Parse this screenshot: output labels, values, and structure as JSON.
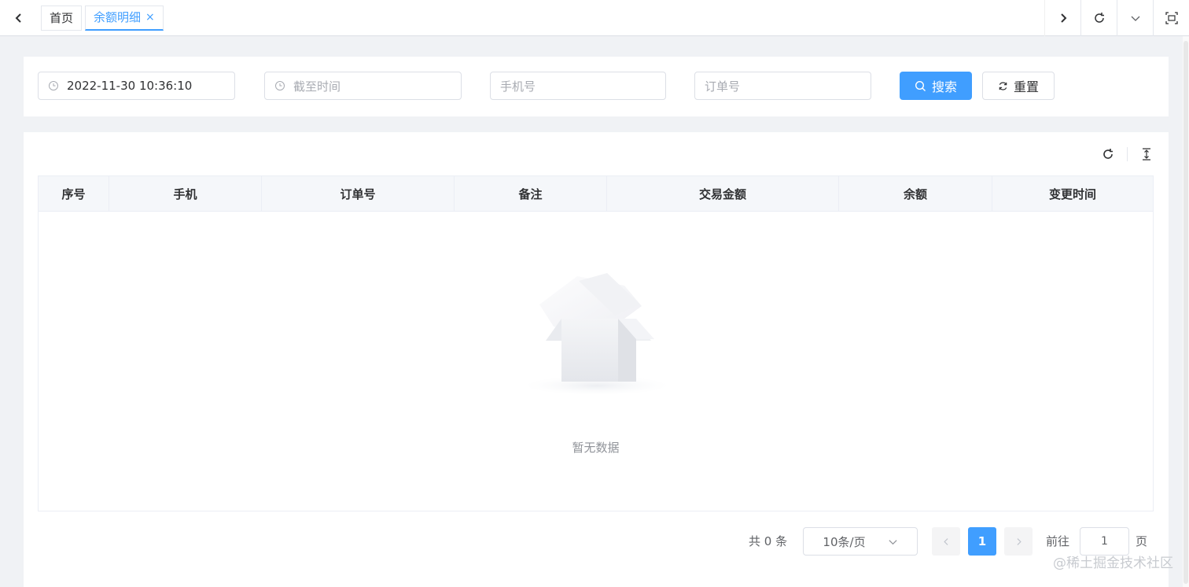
{
  "tabbar": {
    "prev_icon": "chevron-left-icon",
    "tabs": [
      {
        "label": "首页",
        "active": false
      },
      {
        "label": "余额明细",
        "active": true,
        "close": "×"
      }
    ],
    "next_icon": "chevron-right-icon",
    "refresh_icon": "refresh-icon",
    "dropdown_icon": "chevron-down-icon",
    "fullscreen_icon": "fullscreen-icon"
  },
  "search": {
    "start_time": "2022-11-30 10:36:10",
    "end_time_placeholder": "截至时间",
    "phone_placeholder": "手机号",
    "order_placeholder": "订单号",
    "search_label": "搜索",
    "reset_label": "重置"
  },
  "table": {
    "columns": [
      "序号",
      "手机",
      "订单号",
      "备注",
      "交易金额",
      "余额",
      "变更时间"
    ],
    "empty_text": "暂无数据"
  },
  "pagination": {
    "total_text": "共 0 条",
    "page_size": "10条/页",
    "current_page": "1",
    "goto_label": "前往",
    "goto_value": "1",
    "page_suffix": "页"
  },
  "watermark": "@稀土掘金技术社区",
  "colors": {
    "primary": "#409eff",
    "background": "#f0f2f5",
    "border": "#dcdfe6"
  }
}
